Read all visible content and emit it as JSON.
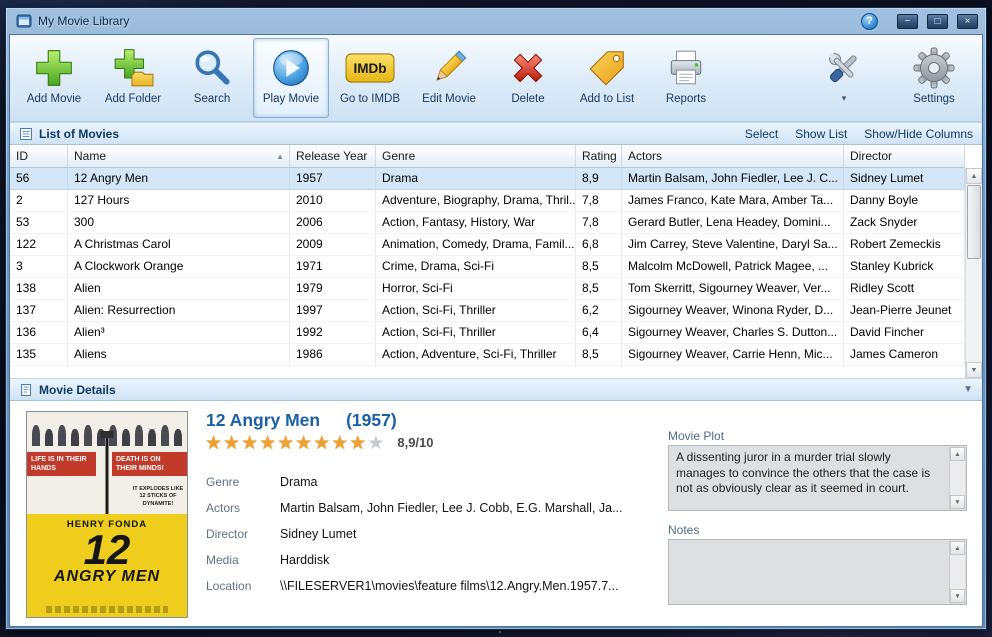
{
  "window": {
    "title": "My Movie Library",
    "controls": {
      "help": "?",
      "minimize": "−",
      "maximize": "□",
      "close": "×"
    }
  },
  "toolbar": {
    "buttons": [
      {
        "label": "Add Movie"
      },
      {
        "label": "Add Folder"
      },
      {
        "label": "Search"
      },
      {
        "label": "Play Movie"
      },
      {
        "label": "Go to IMDB"
      },
      {
        "label": "Edit Movie"
      },
      {
        "label": "Delete"
      },
      {
        "label": "Add to List"
      },
      {
        "label": "Reports"
      }
    ],
    "imdb_logo": "IMDb",
    "tools_arrow": "▾",
    "settings_label": "Settings"
  },
  "list_section": {
    "title": "List of Movies",
    "links": [
      {
        "label": "Select"
      },
      {
        "label": "Show List"
      },
      {
        "label": "Show/Hide Columns"
      }
    ]
  },
  "table": {
    "columns": [
      "ID",
      "Name",
      "Release Year",
      "Genre",
      "Rating",
      "Actors",
      "Director"
    ],
    "sort_indicator": "▲",
    "rows": [
      [
        "56",
        "12 Angry Men",
        "1957",
        "Drama",
        "8,9",
        "Martin Balsam, John Fiedler, Lee J. C...",
        "Sidney Lumet"
      ],
      [
        "2",
        "127 Hours",
        "2010",
        "Adventure, Biography, Drama, Thril...",
        "7,8",
        "James Franco, Kate Mara, Amber Ta...",
        "Danny Boyle"
      ],
      [
        "53",
        "300",
        "2006",
        "Action, Fantasy, History, War",
        "7,8",
        "Gerard Butler, Lena Headey, Domini...",
        "Zack Snyder"
      ],
      [
        "122",
        "A Christmas Carol",
        "2009",
        "Animation, Comedy, Drama, Famil...",
        "6,8",
        "Jim Carrey, Steve Valentine, Daryl Sa...",
        "Robert Zemeckis"
      ],
      [
        "3",
        "A Clockwork Orange",
        "1971",
        "Crime, Drama, Sci-Fi",
        "8,5",
        "Malcolm McDowell, Patrick Magee, ...",
        "Stanley Kubrick"
      ],
      [
        "138",
        "Alien",
        "1979",
        "Horror, Sci-Fi",
        "8,5",
        "Tom Skerritt, Sigourney Weaver, Ver...",
        "Ridley Scott"
      ],
      [
        "137",
        "Alien: Resurrection",
        "1997",
        "Action, Sci-Fi, Thriller",
        "6,2",
        "Sigourney Weaver, Winona Ryder, D...",
        "Jean-Pierre Jeunet"
      ],
      [
        "136",
        "Alien³",
        "1992",
        "Action, Sci-Fi, Thriller",
        "6,4",
        "Sigourney Weaver, Charles S. Dutton...",
        "David Fincher"
      ],
      [
        "135",
        "Aliens",
        "1986",
        "Action, Adventure, Sci-Fi, Thriller",
        "8,5",
        "Sigourney Weaver, Carrie Henn, Mic...",
        "James Cameron"
      ]
    ]
  },
  "details_section": {
    "title": "Movie Details",
    "collapse_arrow": "▼"
  },
  "details": {
    "title": "12 Angry Men",
    "year": "(1957)",
    "stars_full": "★★★★★★★★★",
    "stars_empty": "★",
    "rating_text": "8,9/10",
    "fields": [
      {
        "label": "Genre",
        "value": "Drama"
      },
      {
        "label": "Actors",
        "value": "Martin Balsam, John Fiedler, Lee J. Cobb, E.G. Marshall, Ja..."
      },
      {
        "label": "Director",
        "value": "Sidney Lumet"
      },
      {
        "label": "Media",
        "value": "Harddisk"
      },
      {
        "label": "Location",
        "value": "\\\\FILESERVER1\\movies\\feature films\\12.Angry.Men.1957.7..."
      }
    ],
    "plot_label": "Movie Plot",
    "plot": "A dissenting juror in a murder trial slowly manages to convince the others that the case is not as obviously clear as it seemed in court.",
    "notes_label": "Notes",
    "notes": ""
  },
  "poster": {
    "tagline_left": "LIFE IS IN THEIR HANDS",
    "tagline_right": "DEATH IS ON THEIR MINDS!",
    "burst": "IT EXPLODES LIKE 12 STICKS OF DYNAMITE!",
    "star_name": "HENRY FONDA",
    "title_number": "12",
    "title_words": "ANGRY MEN"
  }
}
